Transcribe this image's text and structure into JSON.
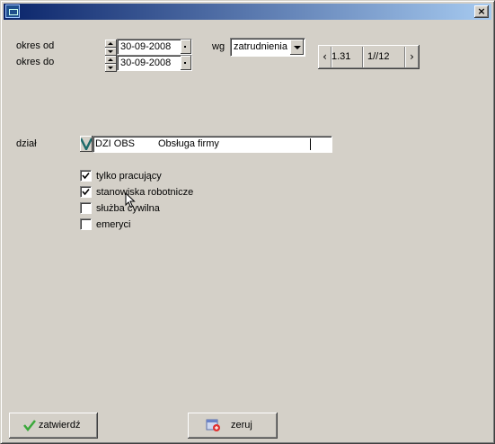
{
  "window": {
    "close_label": "×"
  },
  "period": {
    "from_label": "okres od",
    "to_label": "okres do",
    "from_value": "30-09-2008",
    "to_value": "30-09-2008"
  },
  "grouping": {
    "label": "wg",
    "selected": "zatrudnienia"
  },
  "navigator": {
    "prev": "‹",
    "next": "›",
    "code": "1.31",
    "page": "1//12"
  },
  "department": {
    "label": "dział",
    "code": "DZI OBS",
    "name": "Obsługa firmy"
  },
  "filters": [
    {
      "label": "tylko pracujący",
      "checked": true
    },
    {
      "label": "stanowiska robotnicze",
      "checked": true
    },
    {
      "label": "służba cywilna",
      "checked": false
    },
    {
      "label": "emeryci",
      "checked": false
    }
  ],
  "buttons": {
    "confirm": "zatwierdź",
    "reset": "zeruj"
  },
  "icons": {
    "app": "app-icon",
    "confirm": "checkmark-icon",
    "reset": "reset-icon"
  }
}
